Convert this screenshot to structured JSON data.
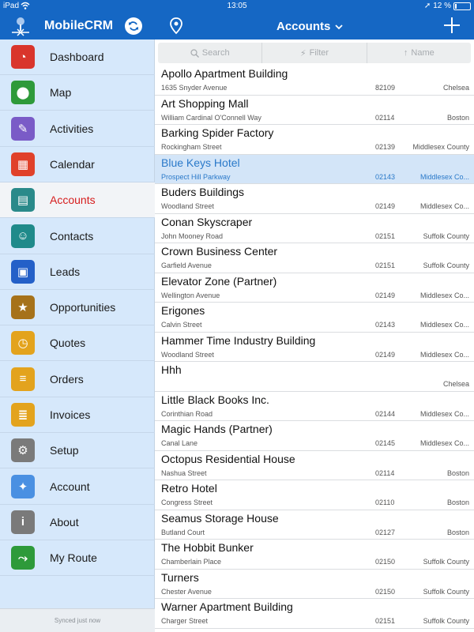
{
  "status_bar": {
    "carrier": "iPad",
    "time": "13:05",
    "battery_percent": "12 %",
    "battery_level": 0.12
  },
  "nav": {
    "app_title": "MobileCRM",
    "section_title": "Accounts"
  },
  "sidebar": {
    "items": [
      {
        "label": "Dashboard",
        "icon": "dashboard-icon",
        "color": "#d9352c"
      },
      {
        "label": "Map",
        "icon": "map-pin-icon",
        "color": "#2e9a3a"
      },
      {
        "label": "Activities",
        "icon": "activities-icon",
        "color": "#7a5bc7"
      },
      {
        "label": "Calendar",
        "icon": "calendar-icon",
        "color": "#e0412a"
      },
      {
        "label": "Accounts",
        "icon": "accounts-icon",
        "color": "#2a8a8a"
      },
      {
        "label": "Contacts",
        "icon": "contacts-icon",
        "color": "#1f8a8a"
      },
      {
        "label": "Leads",
        "icon": "leads-icon",
        "color": "#2460c8"
      },
      {
        "label": "Opportunities",
        "icon": "opportunities-icon",
        "color": "#a6721a"
      },
      {
        "label": "Quotes",
        "icon": "quotes-icon",
        "color": "#e3a31d"
      },
      {
        "label": "Orders",
        "icon": "orders-icon",
        "color": "#e3a31d"
      },
      {
        "label": "Invoices",
        "icon": "invoices-icon",
        "color": "#e3a31d"
      },
      {
        "label": "Setup",
        "icon": "gear-icon",
        "color": "#7a7a7a"
      },
      {
        "label": "Account",
        "icon": "account-settings-icon",
        "color": "#4a90e2"
      },
      {
        "label": "About",
        "icon": "info-icon",
        "color": "#7a7a7a"
      },
      {
        "label": "My Route",
        "icon": "route-icon",
        "color": "#2e9a3a"
      }
    ],
    "active_index": 4,
    "sync_status": "Synced just now"
  },
  "toolbar": {
    "search_label": "Search",
    "filter_label": "Filter",
    "sort_label": "Name"
  },
  "accounts": [
    {
      "name": "Apollo Apartment Building",
      "street": "1635 Snyder Avenue",
      "zip": "82109",
      "city": "Chelsea"
    },
    {
      "name": "Art Shopping Mall",
      "street": "William Cardinal O'Connell Way",
      "zip": "02114",
      "city": "Boston"
    },
    {
      "name": "Barking Spider Factory",
      "street": "Rockingham Street",
      "zip": "02139",
      "city": "Middlesex County"
    },
    {
      "name": "Blue Keys Hotel",
      "street": "Prospect Hill Parkway",
      "zip": "02143",
      "city": "Middlesex Co..."
    },
    {
      "name": "Buders Buildings",
      "street": "Woodland Street",
      "zip": "02149",
      "city": "Middlesex Co..."
    },
    {
      "name": "Conan Skyscraper",
      "street": "John Mooney Road",
      "zip": "02151",
      "city": "Suffolk County"
    },
    {
      "name": "Crown Business Center",
      "street": "Garfield Avenue",
      "zip": "02151",
      "city": "Suffolk County"
    },
    {
      "name": "Elevator Zone (Partner)",
      "street": "Wellington Avenue",
      "zip": "02149",
      "city": "Middlesex Co..."
    },
    {
      "name": "Erigones",
      "street": "Calvin Street",
      "zip": "02143",
      "city": "Middlesex Co..."
    },
    {
      "name": "Hammer Time Industry Building",
      "street": "Woodland Street",
      "zip": "02149",
      "city": "Middlesex Co..."
    },
    {
      "name": "Hhh",
      "street": "",
      "zip": "",
      "city": "Chelsea"
    },
    {
      "name": "Little Black Books Inc.",
      "street": "Corinthian Road",
      "zip": "02144",
      "city": "Middlesex Co..."
    },
    {
      "name": "Magic Hands (Partner)",
      "street": "Canal Lane",
      "zip": "02145",
      "city": "Middlesex Co..."
    },
    {
      "name": "Octopus Residential House",
      "street": "Nashua Street",
      "zip": "02114",
      "city": "Boston"
    },
    {
      "name": "Retro Hotel",
      "street": "Congress Street",
      "zip": "02110",
      "city": "Boston"
    },
    {
      "name": "Seamus Storage House",
      "street": "Butland Court",
      "zip": "02127",
      "city": "Boston"
    },
    {
      "name": "The Hobbit Bunker",
      "street": "Chamberlain Place",
      "zip": "02150",
      "city": "Suffolk County"
    },
    {
      "name": "Turners",
      "street": "Chester Avenue",
      "zip": "02150",
      "city": "Suffolk County"
    },
    {
      "name": "Warner Apartment Building",
      "street": "Charger Street",
      "zip": "02151",
      "city": "Suffolk County"
    }
  ],
  "selected_account_index": 3,
  "colors": {
    "brand": "#1567c4",
    "sidebar_bg": "#d6e8fb",
    "active_label": "#d61d1d",
    "selection_bg": "#d3e5f8",
    "selection_text": "#2a79c9"
  }
}
